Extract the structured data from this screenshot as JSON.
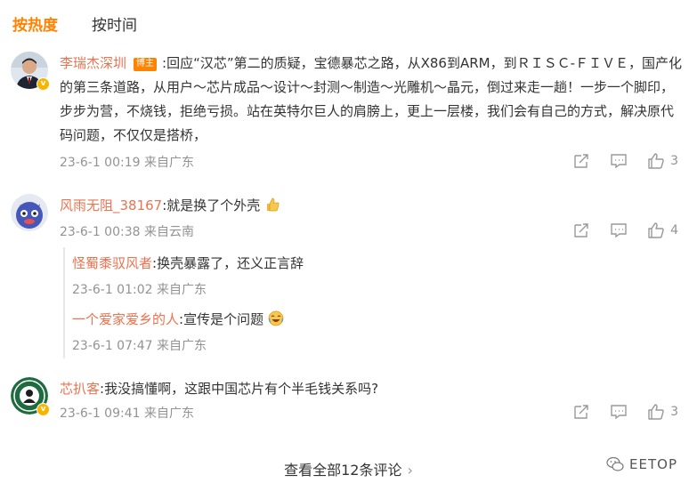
{
  "tabs": [
    {
      "label": "按热度",
      "active": true
    },
    {
      "label": "按时间",
      "active": false
    }
  ],
  "comments": [
    {
      "author": "李瑞杰深圳",
      "badge": "博主",
      "text": ":回应“汉芯”第二的质疑，宝德暴芯之路，从X86到ARM，到ＲＩＳＣ-ＦＩＶＥ，国产化的第三条道路，从用户～芯片成品～设计～封测～制造～光雕机～晶元，倒过来走一趟！一步一个脚印，步步为营，不烧钱，拒绝亏损。站在英特尔巨人的肩膀上，更上一层楼，我们会有自己的方式，解决原代码问题，不仅仅是搭桥，",
      "time": "23-6-1 00:19 来自广东",
      "likes": "3"
    },
    {
      "author": "风雨无阻_38167",
      "text": ":就是换了个外壳",
      "time": "23-6-1 00:38 来自云南",
      "likes": "4",
      "replies": [
        {
          "author": "怪蜀黍驭风者",
          "text": ":换壳暴露了，还义正言辞",
          "time": "23-6-1 01:02 来自广东"
        },
        {
          "author": "一个爱家爱乡的人",
          "text": ":宣传是个问题",
          "time": "23-6-1 07:47 来自广东"
        }
      ]
    },
    {
      "author": "芯扒客",
      "text": ":我没搞懂啊，这跟中国芯片有个半毛钱关系吗?",
      "time": "23-6-1 09:41 来自广东",
      "likes": "3"
    }
  ],
  "view_all": "查看全部12条评论",
  "watermark": "EETOP",
  "colors": {
    "accent": "#ff8200",
    "name": "#eb7350",
    "meta": "#939393"
  },
  "icons": [
    "share-icon",
    "comment-icon",
    "like-icon",
    "thumbs-up-emoji",
    "laughing-emoji",
    "verified-badge-icon",
    "wechat-logo-icon"
  ]
}
